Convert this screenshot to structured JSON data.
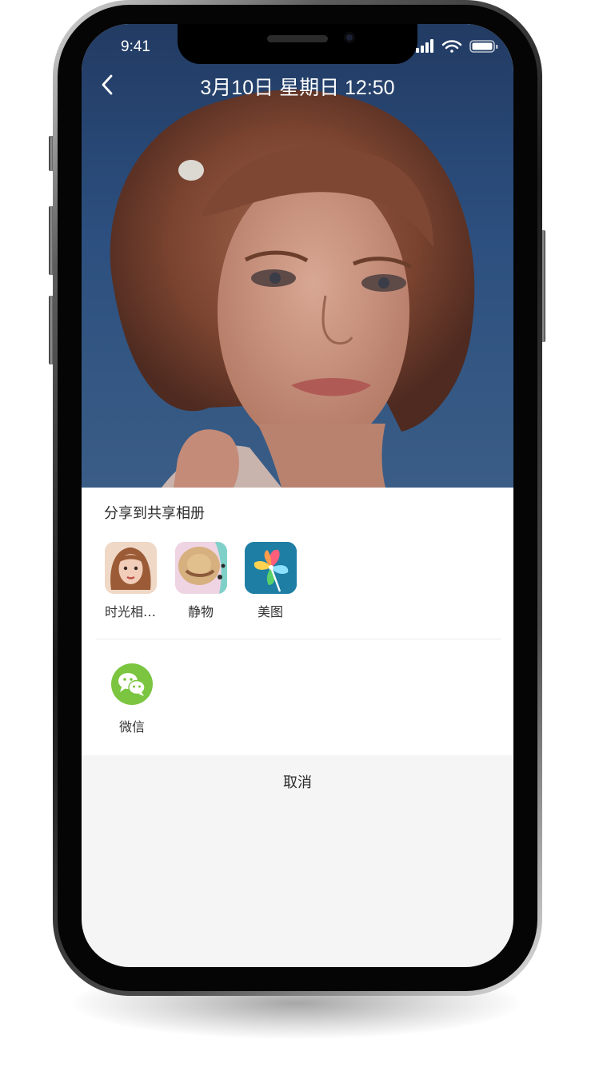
{
  "status_bar": {
    "time": "9:41",
    "icons": [
      "signal-icon",
      "wifi-icon",
      "battery-icon"
    ]
  },
  "nav": {
    "back_icon": "chevron-left-icon",
    "title": "3月10日 星期日 12:50"
  },
  "share_sheet": {
    "section_title": "分享到共享相册",
    "albums": [
      {
        "label": "时光相…",
        "icon": "portrait-thumbnail"
      },
      {
        "label": "静物",
        "icon": "straw-hat-thumbnail"
      },
      {
        "label": "美图",
        "icon": "pinwheel-icon"
      }
    ],
    "apps": [
      {
        "label": "微信",
        "icon": "wechat-icon",
        "color": "#7bc540"
      }
    ]
  },
  "cancel_label": "取消",
  "colors": {
    "wechat_green": "#7bc540",
    "sheet_bg": "#ffffff",
    "footer_bg": "#f5f5f5"
  }
}
